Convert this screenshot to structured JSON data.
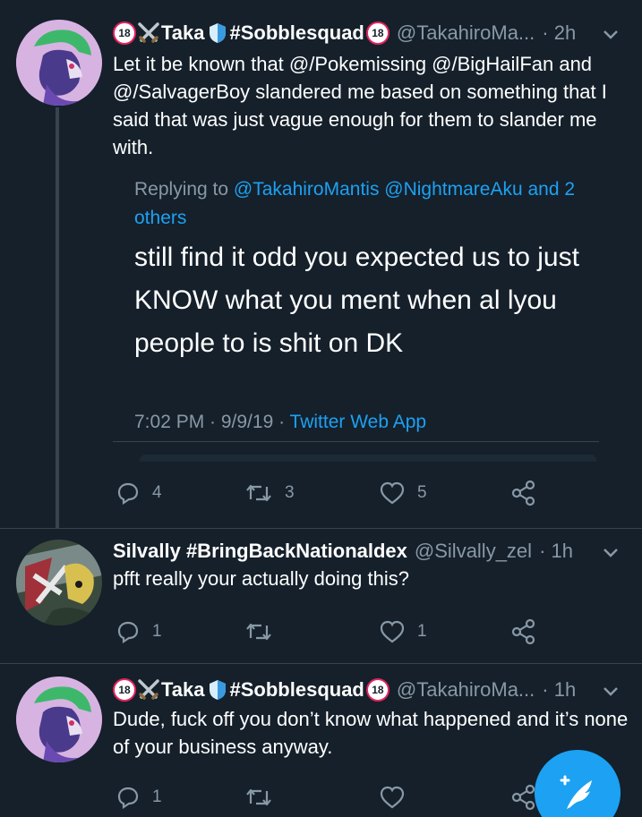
{
  "colors": {
    "background": "#15202b",
    "text": "#ffffff",
    "secondary": "#8899a6",
    "link": "#1da1f2",
    "divider": "#38444d",
    "fab": "#1da1f2"
  },
  "tweets": [
    {
      "name_badge_left": "18",
      "name_emoji_swords": "crossed-swords-icon",
      "name_part1": "Taka",
      "name_emoji_shield": "shield-icon",
      "name_part2": "#Sobblesquad",
      "name_badge_right": "18",
      "handle": "@TakahiroMa...",
      "time": "· 2h",
      "text": "Let it be known that @/Pokemissing @/BigHailFan and @/SalvagerBoy slandered me based on something that I said that was just vague enough for them to slander me with.",
      "quote": {
        "replying_to_prefix": "Replying to ",
        "replying_to_users": "@TakahiroMantis @NightmareAku and 2 others",
        "text": "still find it odd you expected us to just KNOW what you ment when al lyou people to is shit on DK",
        "date": "7:02 PM · 9/9/19 · ",
        "source": "Twitter Web App"
      },
      "replies": "4",
      "retweets": "3",
      "likes": "5"
    },
    {
      "name": "Silvally #BringBackNationaldex",
      "handle": "@Silvally_zel",
      "time": "· 1h",
      "text": "pfft really your actually doing this?",
      "replies": "1",
      "retweets": "",
      "likes": "1"
    },
    {
      "name_badge_left": "18",
      "name_part1": "Taka",
      "name_part2": "#Sobblesquad",
      "name_badge_right": "18",
      "handle": "@TakahiroMa...",
      "time": "· 1h",
      "text": "Dude, fuck off you don’t know what happened and it’s none of your business anyway.",
      "replies": "1",
      "retweets": "",
      "likes": ""
    }
  ],
  "fab": {
    "icon": "compose-tweet-icon"
  }
}
